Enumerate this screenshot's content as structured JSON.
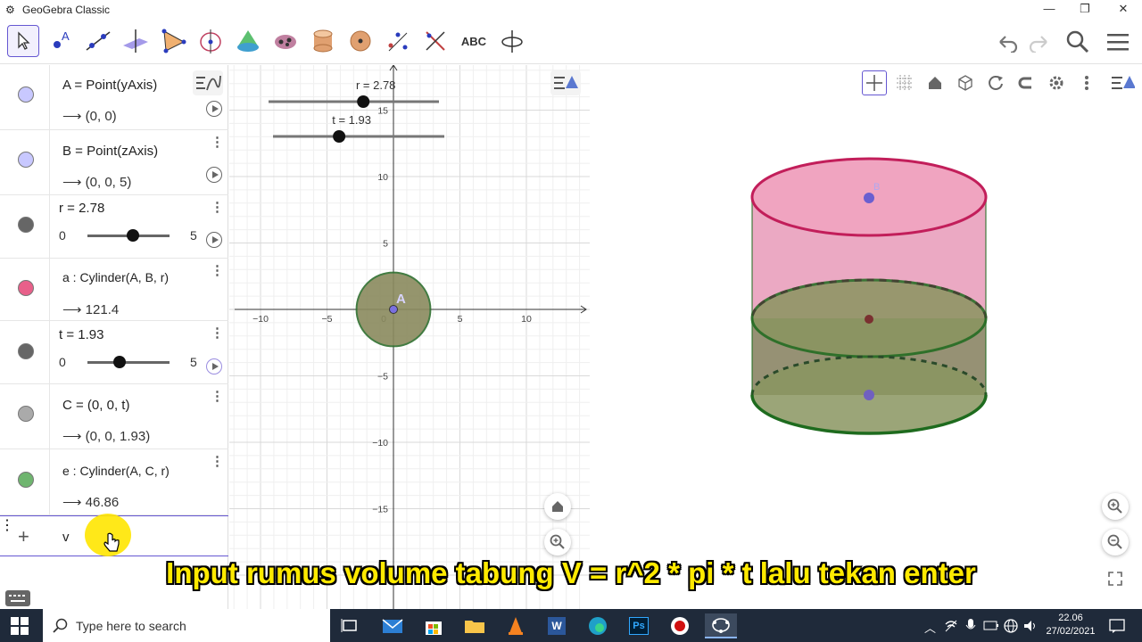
{
  "window": {
    "title": "GeoGebra Classic",
    "minimize": "—",
    "restore": "❐",
    "close": "✕"
  },
  "toolbar": {
    "text_tool_label": "ABC"
  },
  "algebra": {
    "rows": [
      {
        "defn": "A  =  Point(yAxis)",
        "value": "⟶  (0, 0)",
        "color": "#c8c8ff"
      },
      {
        "defn": "B  =  Point(zAxis)",
        "value": "⟶  (0, 0, 5)",
        "color": "#c8c8ff"
      },
      {
        "defn": "r = 2.78",
        "min": "0",
        "max": "5",
        "level": 0.556,
        "color": "#666666"
      },
      {
        "defn": "a : Cylinder(A, B, r)",
        "value": "⟶  121.4",
        "color": "#e8608a"
      },
      {
        "defn": "t = 1.93",
        "min": "0",
        "max": "5",
        "level": 0.386,
        "color": "#666666"
      },
      {
        "defn": "C  =  (0, 0, t)",
        "value": "⟶  (0, 0, 1.93)",
        "color": "#aaaaaa"
      },
      {
        "defn": "e : Cylinder(A, C, r)",
        "value": "⟶  46.86",
        "color": "#6fb56f"
      }
    ],
    "input_text": "v",
    "add_label": "+"
  },
  "graphics": {
    "x_ticks": [
      "−10",
      "−5",
      "0",
      "5",
      "10"
    ],
    "y_ticks": [
      "15",
      "10",
      "5",
      "−5",
      "−10",
      "−15"
    ],
    "slider_r_label": "r = 2.78",
    "slider_t_label": "t = 1.93",
    "point_label": "A"
  },
  "caption": "Input rumus volume tabung V = r^2 * pi * t lalu tekan enter",
  "taskbar": {
    "search_placeholder": "Type here to search",
    "time": "22.06",
    "date": "27/02/2021",
    "word_label": "W",
    "ps_label": "Ps"
  }
}
